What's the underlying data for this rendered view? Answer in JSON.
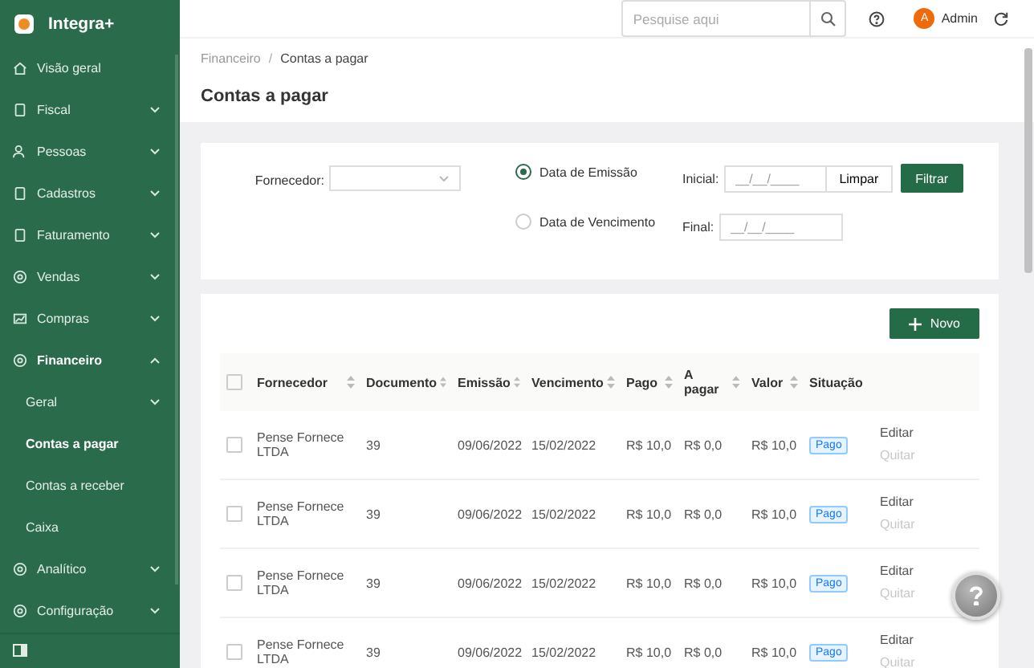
{
  "sidebar": {
    "brand": "Integra+",
    "items": [
      {
        "label": "Visão geral",
        "kind": "link",
        "selected": false
      },
      {
        "label": "Fiscal",
        "kind": "group",
        "expanded": false,
        "selected": false
      },
      {
        "label": "Pessoas",
        "kind": "group",
        "expanded": false,
        "selected": false
      },
      {
        "label": "Cadastros",
        "kind": "group",
        "expanded": false,
        "selected": false
      },
      {
        "label": "Faturamento",
        "kind": "group",
        "expanded": false,
        "selected": false
      },
      {
        "label": "Vendas",
        "kind": "group",
        "expanded": false,
        "selected": false
      },
      {
        "label": "Compras",
        "kind": "group",
        "expanded": false,
        "selected": false
      },
      {
        "label": "Financeiro",
        "kind": "group",
        "expanded": true,
        "selected": true,
        "children": [
          {
            "label": "Geral",
            "kind": "group",
            "selected": false
          },
          {
            "label": "Contas a pagar",
            "kind": "link",
            "selected": true
          },
          {
            "label": "Contas a receber",
            "kind": "link",
            "selected": false
          },
          {
            "label": "Caixa",
            "kind": "link",
            "selected": false
          }
        ]
      },
      {
        "label": "Analítico",
        "kind": "group",
        "expanded": false,
        "selected": false
      },
      {
        "label": "Configuração",
        "kind": "group",
        "expanded": false,
        "selected": false
      }
    ]
  },
  "header": {
    "search": {
      "placeholder": "Pesquise aqui"
    },
    "user": {
      "initial": "A",
      "name": "Admin"
    }
  },
  "breadcrumb": [
    "Financeiro",
    "Contas a pagar"
  ],
  "breadcrumb_separator": "/",
  "title": "Contas a pagar",
  "filter": {
    "supplier_label": "Fornecedor:",
    "date_options": [
      {
        "label": "Data de Emissão",
        "selected": true
      },
      {
        "label": "Data de Vencimento",
        "selected": false
      }
    ],
    "start_label": "Inicial:",
    "start_placeholder": "__/__/____",
    "end_label": "Final:",
    "end_placeholder": "__/__/____",
    "clear_button": "Limpar",
    "filter_button": "Filtrar"
  },
  "new_button": "Novo",
  "table": {
    "select_all_checked": false,
    "columns": [
      {
        "label": "Fornecedor",
        "sortable": true
      },
      {
        "label": "Documento",
        "sortable": true
      },
      {
        "label": "Emissão",
        "sortable": true
      },
      {
        "label": "Vencimento",
        "sortable": true
      },
      {
        "label": "Pago",
        "sortable": true
      },
      {
        "label": "A pagar",
        "sortable": true
      },
      {
        "label": "Valor",
        "sortable": true
      },
      {
        "label": "Situação",
        "sortable": false
      }
    ],
    "rows": [
      {
        "checked": false,
        "cells": [
          "Pense Fornece LTDA",
          "39",
          "09/06/2022",
          "15/02/2022",
          "R$ 10,0",
          "R$ 0,0",
          "R$ 10,0"
        ],
        "status": "Pago",
        "edit": "Editar",
        "settle": "Quitar",
        "settle_disabled": true
      },
      {
        "checked": false,
        "cells": [
          "Pense Fornece LTDA",
          "39",
          "09/06/2022",
          "15/02/2022",
          "R$ 10,0",
          "R$ 0,0",
          "R$ 10,0"
        ],
        "status": "Pago",
        "edit": "Editar",
        "settle": "Quitar",
        "settle_disabled": true
      },
      {
        "checked": false,
        "cells": [
          "Pense Fornece LTDA",
          "39",
          "09/06/2022",
          "15/02/2022",
          "R$ 10,0",
          "R$ 0,0",
          "R$ 10,0"
        ],
        "status": "Pago",
        "edit": "Editar",
        "settle": "Quitar",
        "settle_disabled": true
      },
      {
        "checked": false,
        "cells": [
          "Pense Fornece LTDA",
          "39",
          "09/06/2022",
          "15/02/2022",
          "R$ 10,0",
          "R$ 0,0",
          "R$ 10,0"
        ],
        "status": "Pago",
        "edit": "Editar",
        "settle": "Quitar",
        "settle_disabled": true
      }
    ]
  }
}
